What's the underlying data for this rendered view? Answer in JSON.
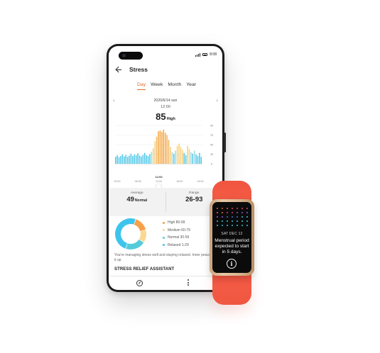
{
  "phone": {
    "status": {
      "time": "8:08"
    },
    "header": {
      "title": "Stress"
    },
    "tabs": [
      {
        "label": "Day",
        "active": true
      },
      {
        "label": "Week",
        "active": false
      },
      {
        "label": "Month",
        "active": false
      },
      {
        "label": "Year",
        "active": false
      }
    ],
    "date": "2020/6/14 sun",
    "selected_time": "12:00",
    "current": {
      "value": "85",
      "level": "High"
    },
    "chart_data": {
      "type": "bar",
      "x_ticks": [
        "00:00",
        "06:00",
        "12:00",
        "18:00",
        "24:00"
      ],
      "selected_tick": "12:00",
      "y_ticks": [
        "99",
        "75",
        "50",
        "25",
        "0"
      ],
      "ylim": [
        0,
        99
      ],
      "values": [
        18,
        22,
        17,
        20,
        24,
        19,
        23,
        18,
        21,
        26,
        20,
        24,
        22,
        27,
        21,
        19,
        23,
        28,
        22,
        20,
        25,
        31,
        40,
        58,
        70,
        84,
        86,
        82,
        88,
        80,
        74,
        62,
        44,
        30,
        26,
        34,
        46,
        52,
        44,
        36,
        28,
        22,
        46,
        38,
        30,
        26,
        34,
        24,
        20,
        28,
        18
      ],
      "colors": {
        "high": "#f5a53c",
        "medium": "#f5cf7a",
        "normal": "#5fc9d9",
        "relaxed": "#4cc7e8"
      }
    },
    "summary": {
      "average_label": "Average",
      "average_value": "49",
      "average_unit": "Normal",
      "range_label": "Range",
      "range_value": "26-93"
    },
    "breakdown": [
      {
        "label": "High 80-99",
        "percent": 14,
        "color": "#f7a04a"
      },
      {
        "label": "Medium 60-79",
        "percent": 12,
        "color": "#f8d98f"
      },
      {
        "label": "Normal 30-59",
        "percent": 19,
        "color": "#55cbd9"
      },
      {
        "label": "Relaxed 1-29",
        "percent": 45,
        "color": "#3ec4ec"
      }
    ],
    "breakdown_display": [
      "14",
      "12",
      "19",
      "44"
    ],
    "advice": "You're managing stress well and staying relaxed. Inner peace is a mindset, keep it up.",
    "assistant_title": "STRESS RELIEF ASSISTANT"
  },
  "band": {
    "date": "SAT DEC 12",
    "message": "Menstrual period expected to start in 5 days.",
    "calendar_colors": [
      "#f06a5a",
      "#f06a5a",
      "#e43b6a",
      "#8b5fd8",
      "#3b6fe0",
      "#3cc4d8"
    ]
  }
}
